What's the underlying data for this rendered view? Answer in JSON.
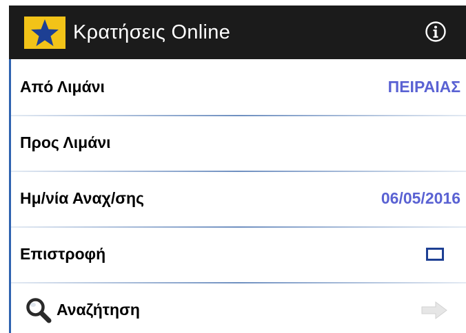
{
  "app_bar": {
    "title": "Κρατήσεις Online",
    "logo_icon": "star-logo-icon",
    "info_icon": "info-icon"
  },
  "form": {
    "departure_port": {
      "label": "Από Λιμάνι",
      "value": "ΠΕΙΡΑΙΑΣ"
    },
    "arrival_port": {
      "label": "Προς Λιμάνι",
      "value": ""
    },
    "departure_date": {
      "label": "Ημ/νία Αναχ/σης",
      "value": "06/05/2016"
    },
    "return_trip": {
      "label": "Επιστροφή",
      "checked": false
    },
    "search": {
      "label": "Αναζήτηση",
      "icon": "search-icon",
      "arrow_icon": "arrow-right-icon"
    }
  },
  "colors": {
    "app_bar_bg": "#1b1b1b",
    "logo_bg": "#f2c318",
    "logo_star": "#1d3f93",
    "accent_value": "#5a62d3",
    "divider": "#6e8fc0",
    "left_accent": "#2f63b0"
  }
}
